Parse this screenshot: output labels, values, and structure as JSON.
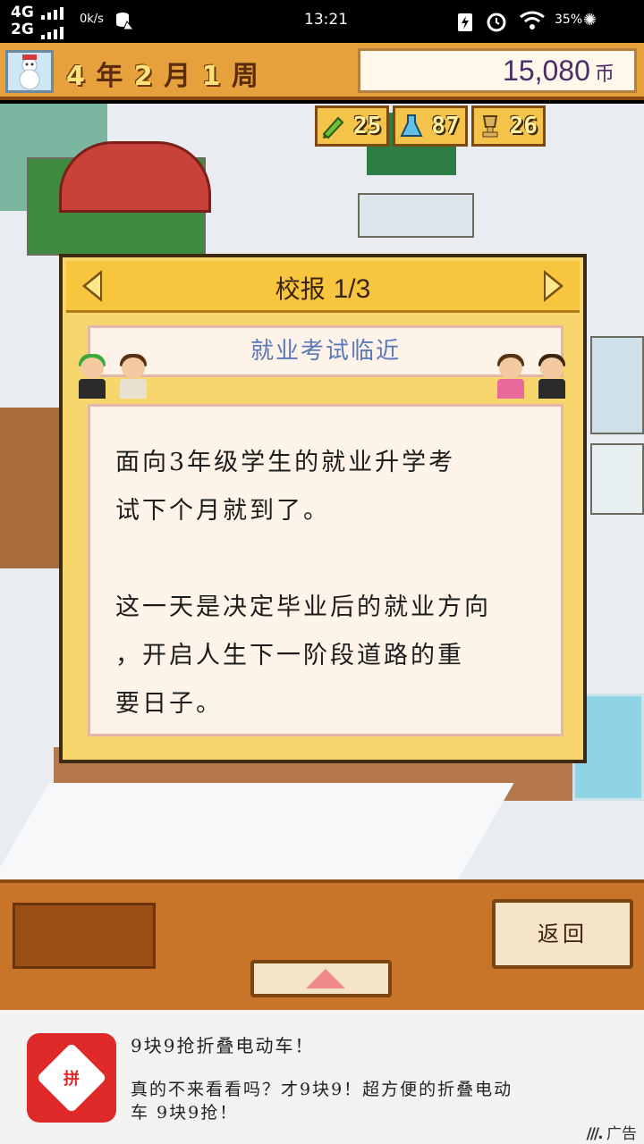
{
  "status_bar": {
    "network_top": "4G",
    "network_bottom": "2G",
    "speed": "0k/s",
    "time": "13:21",
    "battery": "35%"
  },
  "topbar": {
    "year_num": "4",
    "year_unit": "年",
    "month_num": "2",
    "month_unit": "月",
    "week_num": "1",
    "week_unit": "周",
    "money": "15,080",
    "money_unit": "币"
  },
  "resources": [
    {
      "icon": "pencil-icon",
      "value": "25"
    },
    {
      "icon": "flask-icon",
      "value": "87"
    },
    {
      "icon": "trophy-icon",
      "value": "26"
    }
  ],
  "dialog": {
    "title": "校报",
    "page": "1/3",
    "subtitle": "就业考试临近",
    "paragraph1_line1": "面向3年级学生的就业升学考",
    "paragraph1_line2": "试下个月就到了。",
    "paragraph2_line1": "这一天是决定毕业后的就业方向",
    "paragraph2_line2": "，开启人生下一阶段道路的重",
    "paragraph2_line3": "要日子。"
  },
  "bottom": {
    "back_label": "返回"
  },
  "ad": {
    "logo_text": "拼",
    "title": "9块9抢折叠电动车！",
    "description": "真的不来看看吗？才9块9！超方便的折叠电动车 9块9抢！",
    "tag": "广告"
  },
  "colors": {
    "topbar_bg": "#e6a13c",
    "dialog_bg": "#f8d66e",
    "subtitle_text": "#5a78b8",
    "ad_logo": "#e02a2a"
  }
}
